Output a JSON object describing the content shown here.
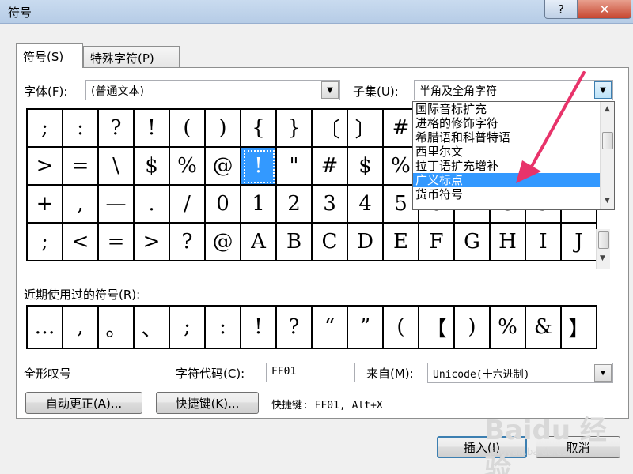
{
  "window": {
    "title": "符号",
    "help_label": "?",
    "close_label": "✕"
  },
  "tabs": [
    {
      "label": "符号(S)",
      "active": true
    },
    {
      "label": "特殊字符(P)",
      "active": false
    }
  ],
  "font": {
    "label": "字体(F):",
    "value": "(普通文本)"
  },
  "subset": {
    "label": "子集(U):",
    "value": "半角及全角字符",
    "options": [
      "国际音标扩充",
      "进格的修饰字符",
      "希腊语和科普特语",
      "西里尔文",
      "拉丁语扩充增补",
      "广义标点",
      "货币符号"
    ],
    "highlighted_index": 5
  },
  "symbol_grid": [
    [
      ";",
      ":",
      "?",
      "!",
      "(",
      ")",
      "{",
      "}",
      "〔",
      "〕",
      "#",
      "",
      "",
      "",
      "",
      ""
    ],
    [
      ">",
      "=",
      "\\",
      "$",
      "%",
      "@",
      "!",
      "\"",
      "#",
      "$",
      "%",
      "",
      "",
      "",
      "",
      ""
    ],
    [
      "+",
      ",",
      "—",
      ".",
      "/",
      "0",
      "1",
      "2",
      "3",
      "4",
      "5",
      "6",
      "7",
      "8",
      "9",
      ""
    ],
    [
      ";",
      "<",
      "=",
      ">",
      "?",
      "@",
      "A",
      "B",
      "C",
      "D",
      "E",
      "F",
      "G",
      "H",
      "I",
      "J"
    ]
  ],
  "selected_symbol": {
    "row": 1,
    "col": 6
  },
  "recent": {
    "label": "近期使用过的符号(R):",
    "symbols": [
      "…",
      ",",
      "。",
      "、",
      ";",
      ":",
      "!",
      "?",
      "“",
      "”",
      "(",
      "【",
      ")",
      "%",
      "&",
      "】"
    ]
  },
  "char_name": "全形叹号",
  "char_code": {
    "label": "字符代码(C):",
    "value": "FF01"
  },
  "from": {
    "label": "来自(M):",
    "value": "Unicode(十六进制)"
  },
  "buttons": {
    "autocorrect": "自动更正(A)...",
    "shortcut_key": "快捷键(K)...",
    "insert": "插入(I)",
    "cancel": "取消"
  },
  "shortcut_text": "快捷键: FF01, Alt+X",
  "watermark": {
    "logo": "Baidu 经验",
    "url": "jingyan.baidu.com"
  },
  "colors": {
    "selection": "#3399ff",
    "annotation_arrow": "#e8336a"
  }
}
